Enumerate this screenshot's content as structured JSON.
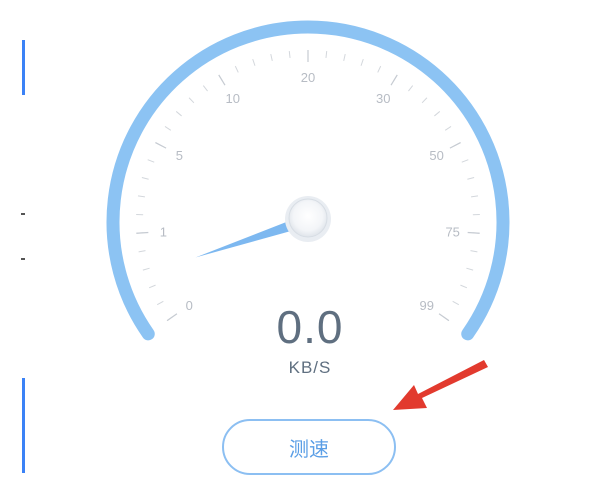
{
  "gauge": {
    "ticks": [
      {
        "label": "0",
        "fraction": 0.0
      },
      {
        "label": "1",
        "fraction": 0.125
      },
      {
        "label": "5",
        "fraction": 0.25
      },
      {
        "label": "10",
        "fraction": 0.375
      },
      {
        "label": "20",
        "fraction": 0.5
      },
      {
        "label": "30",
        "fraction": 0.625
      },
      {
        "label": "50",
        "fraction": 0.75
      },
      {
        "label": "75",
        "fraction": 0.875
      },
      {
        "label": "99",
        "fraction": 1.0
      }
    ],
    "needle_fraction": 0.07,
    "arc_color": "#8cc3f3",
    "needle_color": "#6fb0ee"
  },
  "readout": {
    "value": "0.0",
    "unit": "KB/S"
  },
  "actions": {
    "test_button_label": "测速"
  },
  "colors": {
    "annotation_arrow": "#e23a2e",
    "accent": "#5a9ee6"
  }
}
